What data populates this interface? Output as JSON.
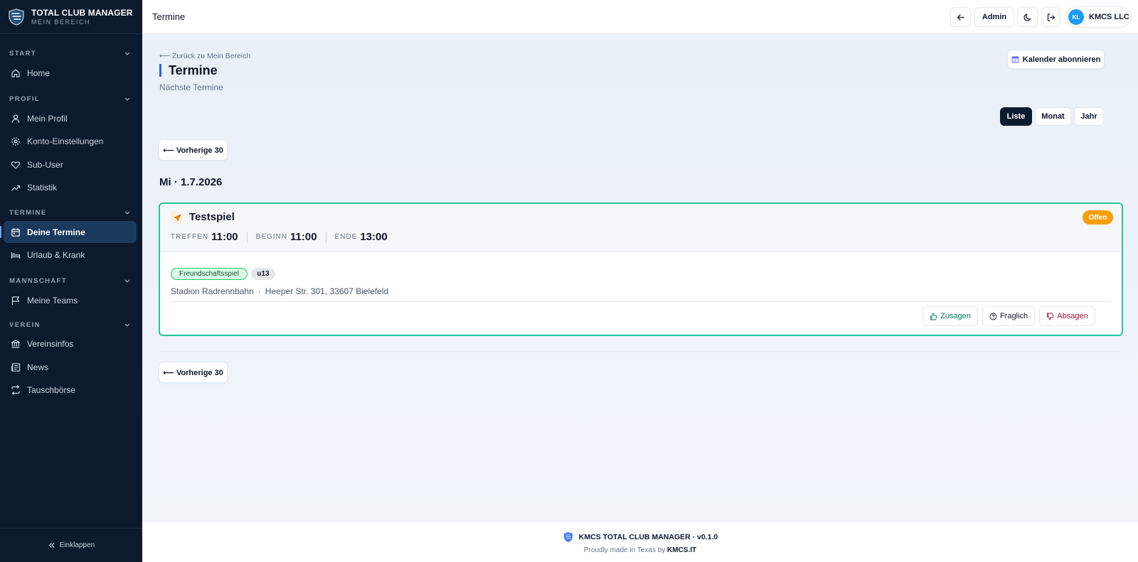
{
  "brand": {
    "title": "TOTAL CLUB MANAGER",
    "subtitle": "MEIN BEREICH"
  },
  "sidebar": {
    "sections": [
      {
        "label": "START",
        "items": [
          {
            "label": "Home",
            "icon": "home-icon"
          }
        ]
      },
      {
        "label": "PROFIL",
        "items": [
          {
            "label": "Mein Profil",
            "icon": "user-icon"
          },
          {
            "label": "Konto-Einstellungen",
            "icon": "gear-icon"
          },
          {
            "label": "Sub-User",
            "icon": "heart-icon"
          },
          {
            "label": "Statistik",
            "icon": "trend-icon"
          }
        ]
      },
      {
        "label": "TERMINE",
        "items": [
          {
            "label": "Deine Termine",
            "icon": "calendar-icon",
            "active": true
          },
          {
            "label": "Urlaub & Krank",
            "icon": "bed-icon"
          }
        ]
      },
      {
        "label": "MANNSCHAFT",
        "items": [
          {
            "label": "Meine Teams",
            "icon": "flag-icon"
          }
        ]
      },
      {
        "label": "VEREIN",
        "items": [
          {
            "label": "Vereinsinfos",
            "icon": "bank-icon"
          },
          {
            "label": "News",
            "icon": "newspaper-icon"
          },
          {
            "label": "Tauschbörse",
            "icon": "swap-icon"
          }
        ]
      }
    ],
    "collapse_label": "Einklappen"
  },
  "topbar": {
    "title": "Termine",
    "admin_label": "Admin",
    "user_initials": "KL",
    "user_name": "KMCS LLC"
  },
  "page": {
    "back_link": "⟵ Zurück zu Mein Bereich",
    "title": "Termine",
    "subtitle": "Nächste Termine",
    "subscribe_label": "Kalender abonnieren",
    "view_modes": [
      "Liste",
      "Monat",
      "Jahr"
    ],
    "active_view": "Liste",
    "prev_label": "⟵ Vorherige 30"
  },
  "events": {
    "date_heading": "Mi · 1.7.2026",
    "name": "Testspiel",
    "status": "Offen",
    "status_color": "#f59e0b",
    "accent_color": "#22c79a",
    "times": {
      "meet_label": "TREFFEN",
      "meet": "11:00",
      "start_label": "BEGINN",
      "start": "11:00",
      "end_label": "ENDE",
      "end": "13:00"
    },
    "tags": [
      "Freundschaftsspiel",
      "u13"
    ],
    "venue": "Stadion Radrennbahn",
    "address": "Heeper Str. 301, 33607 Bielefeld",
    "actions": {
      "yes": "Zusagen",
      "maybe": "Fraglich",
      "no": "Absagen"
    }
  },
  "footer": {
    "line1": "KMCS TOTAL CLUB MANAGER · v0.1.0",
    "line2_prefix": "Proudly made in Texas by",
    "line2_brand": "KMCS.IT"
  }
}
